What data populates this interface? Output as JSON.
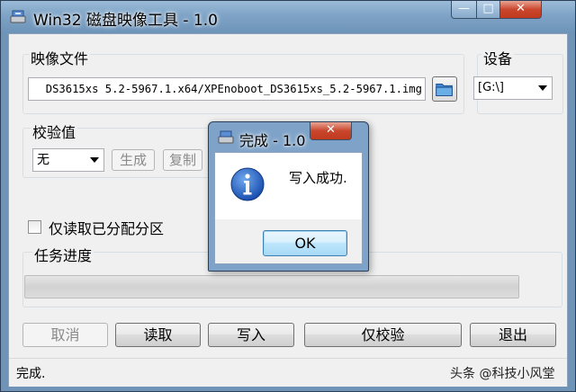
{
  "window": {
    "title": "Win32 磁盘映像工具 - 1.0",
    "minimize_glyph": "—",
    "maximize_glyph": "□",
    "close_glyph": "✕"
  },
  "image_file": {
    "label": "映像文件",
    "path": "DS3615xs 5.2-5967.1.x64/XPEnoboot_DS3615xs_5.2-5967.1.img",
    "browse_icon": "folder-icon"
  },
  "device": {
    "label": "设备",
    "selected": "[G:\\]"
  },
  "checksum": {
    "label": "校验值",
    "algorithm": "无",
    "generate_label": "生成",
    "copy_label": "复制"
  },
  "readonly_partitions": {
    "label": "仅读取已分配分区",
    "checked": false
  },
  "progress": {
    "label": "任务进度",
    "value": 0
  },
  "buttons": {
    "cancel": "取消",
    "read": "读取",
    "write": "写入",
    "verify_only": "仅校验",
    "exit": "退出"
  },
  "status": {
    "text": "完成.",
    "right_text": "头条 @科技小风堂"
  },
  "dialog": {
    "title": "完成 - 1.0",
    "close_glyph": "✕",
    "icon": "info-icon",
    "message": "写入成功.",
    "ok_label": "OK"
  },
  "colors": {
    "titlebar": "#7ea3c6",
    "client_bg": "#f0f0f0",
    "close_red": "#c9462c",
    "info_blue": "#1e5fc4"
  }
}
